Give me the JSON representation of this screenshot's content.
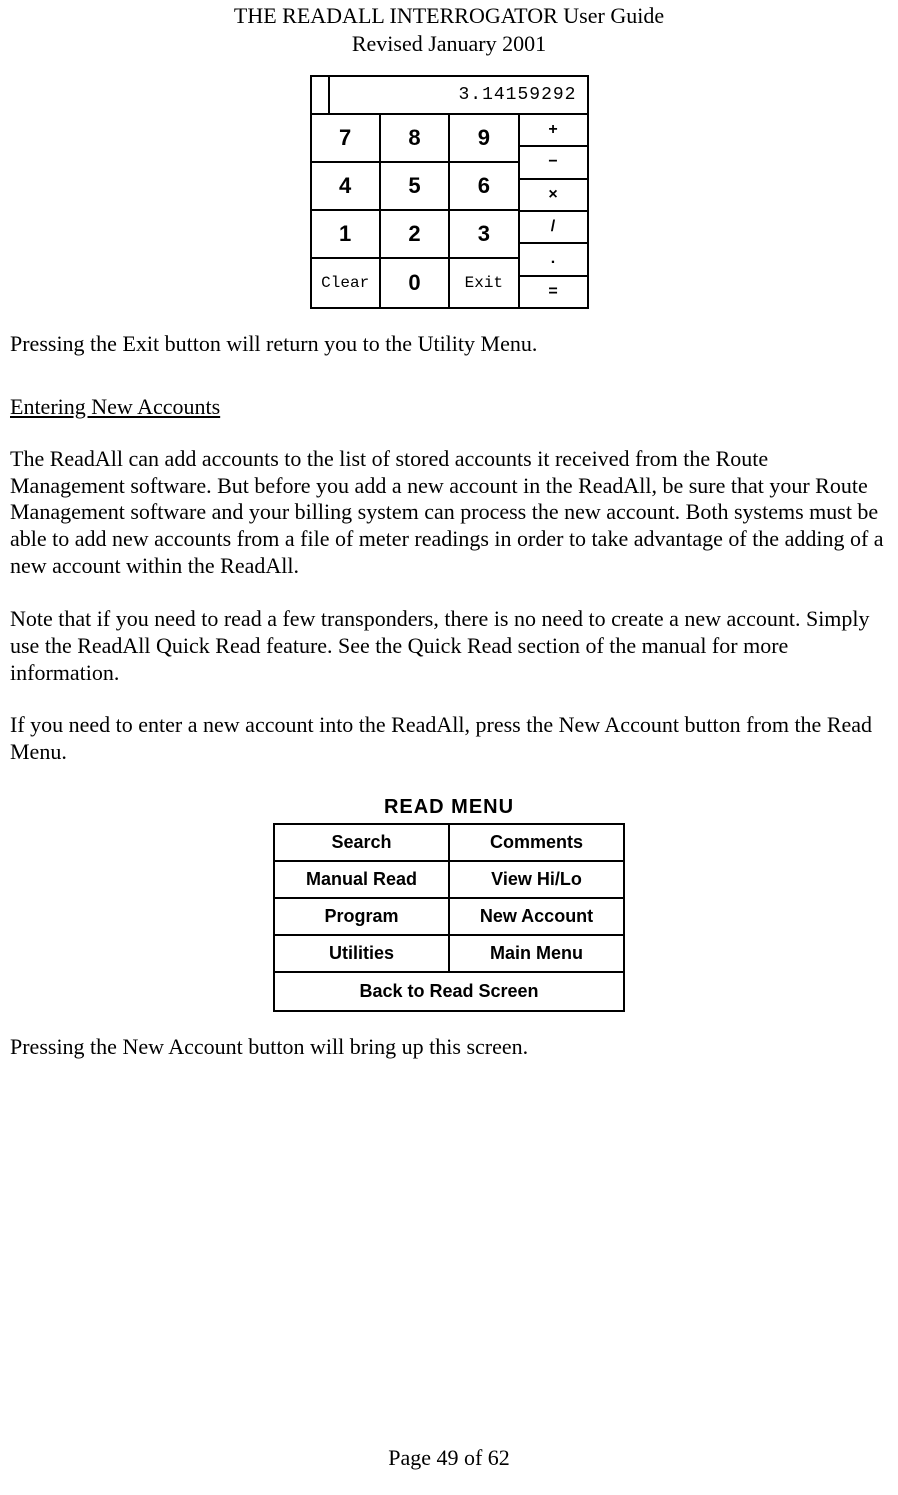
{
  "header": {
    "title": "THE READALL INTERROGATOR User Guide",
    "revised": "Revised January 2001"
  },
  "calculator": {
    "display": "3.14159292",
    "row1": [
      "7",
      "8",
      "9"
    ],
    "row2": [
      "4",
      "5",
      "6"
    ],
    "row3": [
      "1",
      "2",
      "3"
    ],
    "row4": [
      "Clear",
      "0",
      "Exit"
    ],
    "ops": [
      "+",
      "−",
      "×",
      "/",
      ".",
      "="
    ]
  },
  "p_exit": "Pressing the Exit button will return you to the Utility Menu.",
  "section_heading": "Entering New Accounts",
  "p_intro": "The ReadAll can add accounts to the list of stored accounts it received from the Route Management software.  But before you add a new account in the ReadAll, be sure that your Route Management software and your billing system can process the new account.  Both systems must be able to add new accounts from a file of meter readings in order to take advantage of the adding of a new account within the ReadAll.",
  "p_note": "Note that if you need to read a few transponders, there is no need to create a new account.  Simply use the ReadAll Quick Read feature.  See the Quick Read section of the manual for more information.",
  "p_instruction": "If you need to enter a new account into the ReadAll, press the New Account button from the Read Menu.",
  "read_menu": {
    "title": "READ MENU",
    "rows": [
      [
        "Search",
        "Comments"
      ],
      [
        "Manual Read",
        "View Hi/Lo"
      ],
      [
        "Program",
        "New Account"
      ],
      [
        "Utilities",
        "Main Menu"
      ]
    ],
    "footer": "Back to Read Screen"
  },
  "p_followup": "Pressing the New Account button will bring up this screen.",
  "footer": "Page 49 of 62"
}
